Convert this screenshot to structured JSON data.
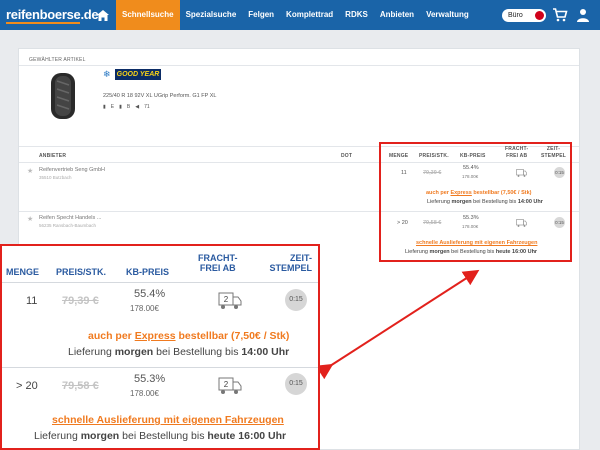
{
  "header": {
    "logo_main": "reifenboerse",
    "logo_suffix": ".de",
    "nav": [
      "Schnellsuche",
      "Spezialsuche",
      "Felgen",
      "Komplettrad",
      "RDKS",
      "Anbieten",
      "Verwaltung"
    ],
    "mode_label": "Büro"
  },
  "article": {
    "section_label": "GEWÄHLTER ARTIKEL",
    "brand": "GOOD YEAR",
    "description": "225/40 R 18 92V XL UGrip Perform. G1 FP XL",
    "eu_fuel": "E",
    "eu_wet": "B",
    "eu_noise": "71"
  },
  "table": {
    "headers": {
      "anbieter": "ANBIETER",
      "dot": "DOT",
      "menge": "MENGE",
      "preis": "PREIS/STK.",
      "kb": "KB-PREIS",
      "fracht": "FRACHT-\nFREI AB",
      "zeit": "ZEIT-\nSTEMPEL"
    },
    "rows": [
      {
        "seller": "Reifenvertrieb Seng GmbH",
        "location": "35510 Butzbach",
        "qty": "11",
        "price": "79,39 €",
        "kb_pct": "55.4%",
        "kb_value": "178.00€",
        "freight": "2",
        "time": "0:15",
        "note_pre": "auch per ",
        "note_link": "Express",
        "note_post": " bestellbar (7,50€ / Stk)",
        "deliv_pre": "Lieferung ",
        "deliv_bold1": "morgen",
        "deliv_mid": " bei Bestellung bis ",
        "deliv_bold2": "14:00 Uhr"
      },
      {
        "seller": "Reifen Specht Handels ...",
        "location": "56235 Ransbach-Baumbach",
        "qty": "> 20",
        "price": "79,58 €",
        "kb_pct": "55.3%",
        "kb_value": "178.00€",
        "freight": "2",
        "time": "0:15",
        "note_link": "schnelle Auslieferung mit eigenen Fahrzeugen",
        "deliv_pre": "Lieferung ",
        "deliv_bold1": "morgen",
        "deliv_mid": " bei Bestellung bis ",
        "deliv_bold2": "heute 16:00 Uhr"
      }
    ]
  },
  "colors": {
    "nav_bg": "#1a64a8",
    "active_tab": "#f08c1c",
    "highlight": "#e2211c",
    "note": "#f07a1f",
    "header_text": "#2a5aa0"
  }
}
